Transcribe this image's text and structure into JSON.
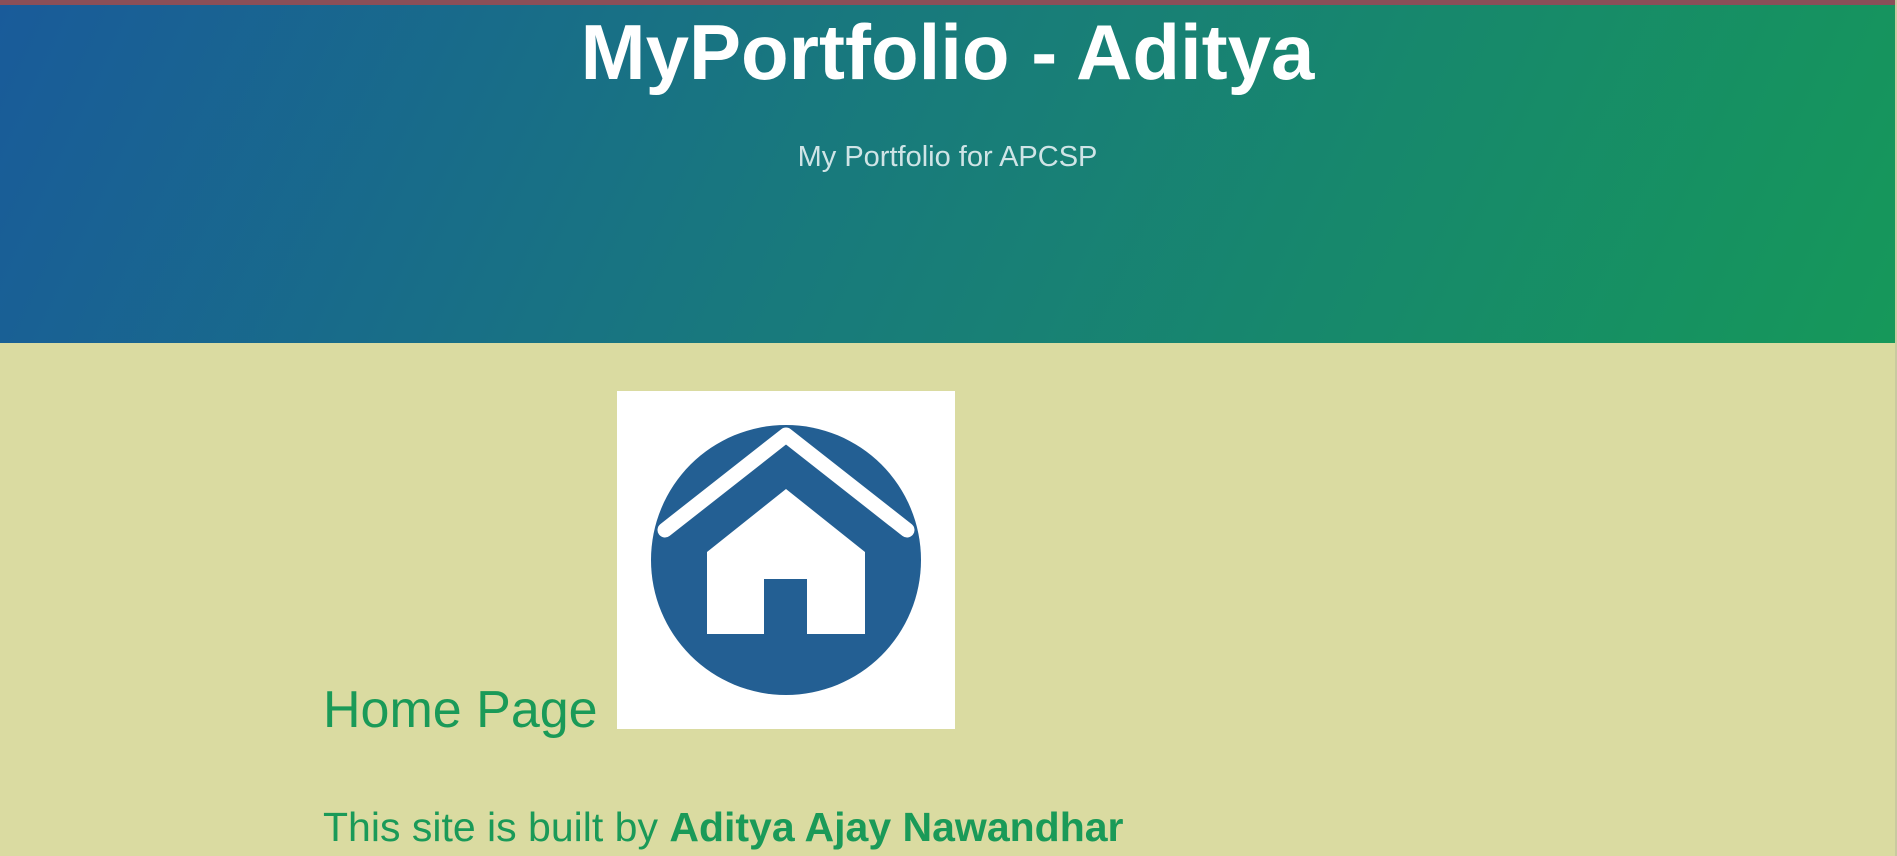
{
  "header": {
    "title": "MyPortfolio - Aditya",
    "subtitle": "My Portfolio for APCSP"
  },
  "main": {
    "heading": "Home Page",
    "home_image": {
      "icon": "home-icon",
      "circle_color": "#235f93"
    },
    "credit_prefix": "This site is built by ",
    "credit_name": "Aditya Ajay Nawandhar"
  },
  "colors": {
    "header_gradient_start": "#195b9a",
    "header_gradient_end": "#16985a",
    "page_background": "#dadba1",
    "accent_text": "#1a9a58"
  }
}
